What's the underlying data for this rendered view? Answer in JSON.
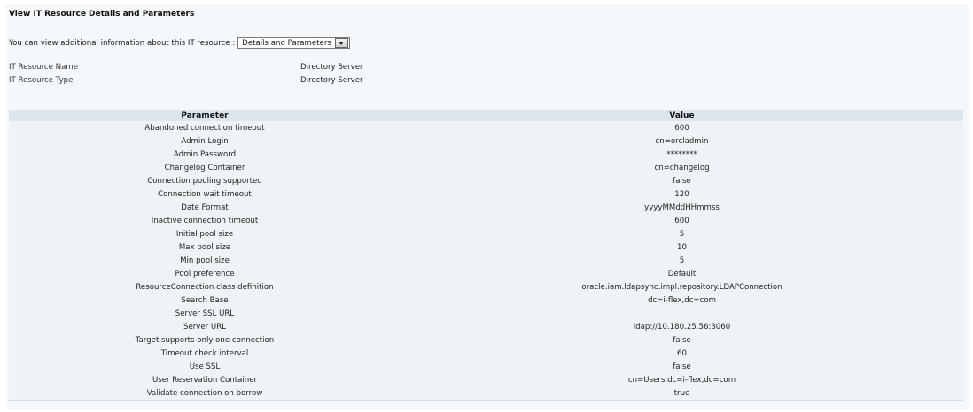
{
  "page": {
    "title": "View IT Resource Details and Parameters",
    "view_prompt": "You can view additional information about this IT resource :",
    "view_select": "Details and Parameters"
  },
  "resource": {
    "name_label": "IT Resource Name",
    "name_value": "Directory Server",
    "type_label": "IT Resource Type",
    "type_value": "Directory Server"
  },
  "table": {
    "headers": [
      "Parameter",
      "Value"
    ],
    "rows": [
      {
        "param": "Abandoned connection timeout",
        "value": "600"
      },
      {
        "param": "Admin Login",
        "value": "cn=orcladmin"
      },
      {
        "param": "Admin Password",
        "value": "********"
      },
      {
        "param": "Changelog Container",
        "value": "cn=changelog"
      },
      {
        "param": "Connection pooling supported",
        "value": "false"
      },
      {
        "param": "Connection wait timeout",
        "value": "120"
      },
      {
        "param": "Date Format",
        "value": "yyyyMMddHHmmss"
      },
      {
        "param": "Inactive connection timeout",
        "value": "600"
      },
      {
        "param": "Initial pool size",
        "value": "5"
      },
      {
        "param": "Max pool size",
        "value": "10"
      },
      {
        "param": "Min pool size",
        "value": "5"
      },
      {
        "param": "Pool preference",
        "value": "Default"
      },
      {
        "param": "ResourceConnection class definition",
        "value": "oracle.iam.ldapsync.impl.repository.LDAPConnection"
      },
      {
        "param": "Search Base",
        "value": "dc=i-flex,dc=com"
      },
      {
        "param": "Server SSL URL",
        "value": ""
      },
      {
        "param": "Server URL",
        "value": "ldap://10.180.25.56:3060"
      },
      {
        "param": "Target supports only one connection",
        "value": "false"
      },
      {
        "param": "Timeout check interval",
        "value": "60"
      },
      {
        "param": "Use SSL",
        "value": "false"
      },
      {
        "param": "User Reservation Container",
        "value": "cn=Users,dc=i-flex,dc=com"
      },
      {
        "param": "Validate connection on borrow",
        "value": "true"
      }
    ]
  }
}
